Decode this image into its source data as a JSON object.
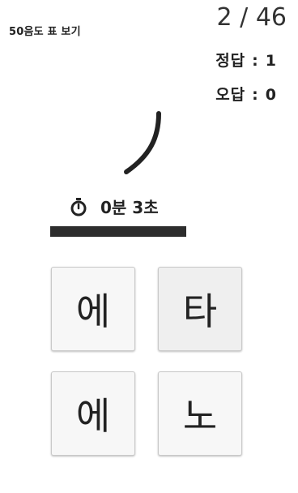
{
  "header": {
    "chart_link_label": "50음도 표 보기",
    "progress_current": "2",
    "progress_separator": "/",
    "progress_total": "46"
  },
  "score": {
    "correct_label": "정답",
    "correct_value": "1",
    "wrong_label": "오답",
    "wrong_value": "0",
    "separator": ":"
  },
  "question": {
    "glyph_icon": "katakana-no-stroke-icon"
  },
  "timer": {
    "icon": "stopwatch-icon",
    "text": "0분 3초",
    "remaining_fraction": 1.0
  },
  "choices": [
    {
      "label": "에"
    },
    {
      "label": "타"
    },
    {
      "label": "에"
    },
    {
      "label": "노"
    }
  ],
  "colors": {
    "text": "#222222",
    "timebar_fill": "#2d2d2d",
    "button_bg": "#f7f7f7",
    "button_border": "#c9c9c9"
  }
}
